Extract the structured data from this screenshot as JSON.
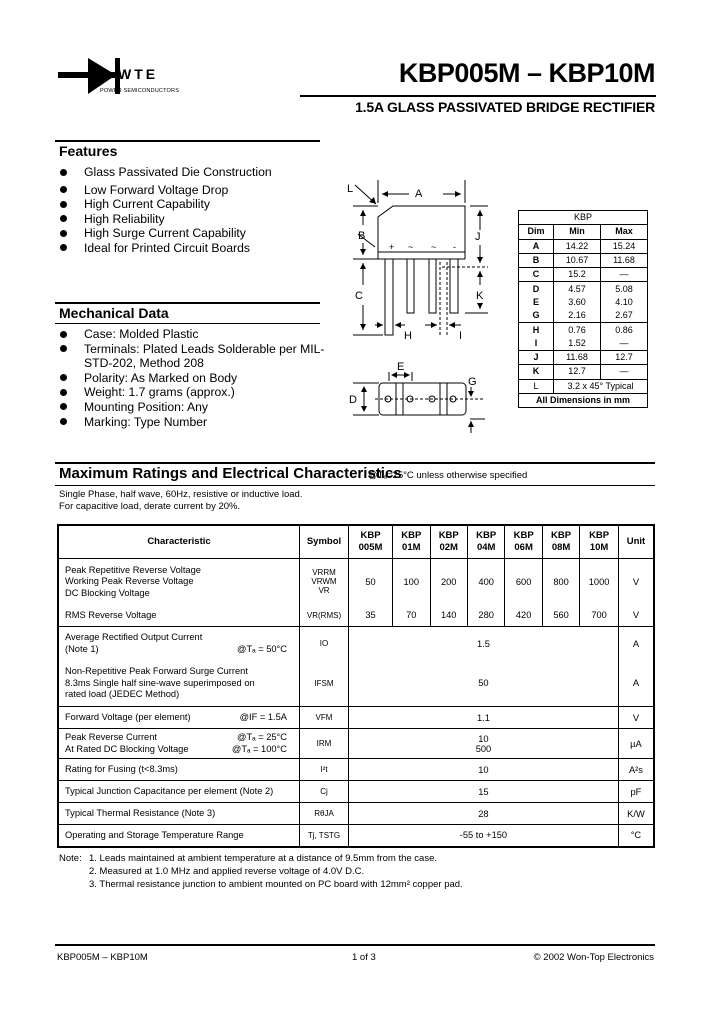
{
  "header": {
    "logo_text": "WTE",
    "logo_subtext": "POWER SEMICONDUCTORS",
    "title": "KBP005M – KBP10M",
    "subtitle": "1.5A GLASS PASSIVATED BRIDGE RECTIFIER"
  },
  "features": {
    "heading": "Features",
    "items": [
      "Glass Passivated Die Construction",
      "Low Forward Voltage Drop",
      "High Current Capability",
      "High Reliability",
      "High Surge Current Capability",
      "Ideal for Printed Circuit Boards"
    ]
  },
  "mechanical": {
    "heading": "Mechanical Data",
    "items": [
      "Case: Molded Plastic",
      "Terminals: Plated Leads Solderable per MIL-STD-202, Method 208",
      "Polarity: As Marked on Body",
      "Weight: 1.7 grams (approx.)",
      "Mounting Position: Any",
      "Marking: Type Number"
    ]
  },
  "diagram": {
    "labels": [
      "L",
      "A",
      "B",
      "J",
      "C",
      "K",
      "H",
      "I",
      "E",
      "D",
      "G"
    ],
    "pin_marks": [
      "+",
      "~",
      "~",
      "-"
    ]
  },
  "dimensions": {
    "package": "KBP",
    "headers": [
      "Dim",
      "Min",
      "Max"
    ],
    "rows": [
      {
        "dim": "A",
        "min": "14.22",
        "max": "15.24"
      },
      {
        "dim": "B",
        "min": "10.67",
        "max": "11.68"
      },
      {
        "dim": "C",
        "min": "15.2",
        "max": "—"
      },
      {
        "dim": "D",
        "min": "4.57",
        "max": "5.08"
      },
      {
        "dim": "E",
        "min": "3.60",
        "max": "4.10"
      },
      {
        "dim": "G",
        "min": "2.16",
        "max": "2.67"
      },
      {
        "dim": "H",
        "min": "0.76",
        "max": "0.86"
      },
      {
        "dim": "I",
        "min": "1.52",
        "max": "—"
      },
      {
        "dim": "J",
        "min": "11.68",
        "max": "12.7"
      },
      {
        "dim": "K",
        "min": "12.7",
        "max": "—"
      },
      {
        "dim": "L",
        "span": "3.2 x 45° Typical"
      }
    ],
    "footer": "All Dimensions in mm"
  },
  "ratings": {
    "heading": "Maximum Ratings and Electrical Characteristics",
    "condition": "@Tₐ=25°C unless otherwise specified",
    "notes": [
      "Single Phase, half wave, 60Hz, resistive or inductive load.",
      "For capacitive load, derate current by 20%."
    ],
    "headers": {
      "characteristic": "Characteristic",
      "symbol": "Symbol",
      "parts": [
        [
          "KBP",
          "005M"
        ],
        [
          "KBP",
          "01M"
        ],
        [
          "KBP",
          "02M"
        ],
        [
          "KBP",
          "04M"
        ],
        [
          "KBP",
          "06M"
        ],
        [
          "KBP",
          "08M"
        ],
        [
          "KBP",
          "10M"
        ]
      ],
      "unit": "Unit"
    },
    "rows": [
      {
        "lines": [
          "Peak Repetitive Reverse Voltage",
          "Working Peak Reverse Voltage",
          "DC Blocking Voltage"
        ],
        "symbols": [
          "VRRM",
          "VRWM",
          "VR"
        ],
        "values": [
          "50",
          "100",
          "200",
          "400",
          "600",
          "800",
          "1000"
        ],
        "unit": "V"
      },
      {
        "lines": [
          "RMS Reverse Voltage"
        ],
        "symbols": [
          "VR(RMS)"
        ],
        "values": [
          "35",
          "70",
          "140",
          "280",
          "420",
          "560",
          "700"
        ],
        "unit": "V"
      },
      {
        "lines": [
          "Average Rectified Output Current",
          "(Note 1)"
        ],
        "condition": "@Tₐ = 50°C",
        "symbols": [
          "IO"
        ],
        "value": "1.5",
        "unit": "A"
      },
      {
        "lines": [
          "Non-Repetitive Peak Forward Surge Current",
          "8.3ms Single half sine-wave superimposed on",
          "rated load (JEDEC Method)"
        ],
        "symbols": [
          "IFSM"
        ],
        "value": "50",
        "unit": "A"
      },
      {
        "lines": [
          "Forward Voltage (per element)"
        ],
        "condition": "@IF = 1.5A",
        "symbols": [
          "VFM"
        ],
        "value": "1.1",
        "unit": "V"
      },
      {
        "lines": [
          "Peak Reverse Current",
          "At Rated DC Blocking Voltage"
        ],
        "conditions": [
          "@Tₐ = 25°C",
          "@Tₐ = 100°C"
        ],
        "symbols": [
          "IRM"
        ],
        "values2": [
          "10",
          "500"
        ],
        "unit": "µA"
      },
      {
        "lines": [
          "Rating for Fusing (t<8.3ms)"
        ],
        "symbols": [
          "I²t"
        ],
        "value": "10",
        "unit": "A²s"
      },
      {
        "lines": [
          "Typical Junction Capacitance per element (Note 2)"
        ],
        "symbols": [
          "Cj"
        ],
        "value": "15",
        "unit": "pF"
      },
      {
        "lines": [
          "Typical Thermal Resistance (Note 3)"
        ],
        "symbols": [
          "RθJA"
        ],
        "value": "28",
        "unit": "K/W"
      },
      {
        "lines": [
          "Operating and Storage Temperature Range"
        ],
        "symbols": [
          "Tj, TSTG"
        ],
        "value": "-55 to +150",
        "unit": "°C"
      }
    ]
  },
  "footnotes": {
    "label": "Note:",
    "items": [
      "1. Leads maintained at ambient temperature at a distance of 9.5mm from the case.",
      "2. Measured at 1.0 MHz and applied reverse voltage of 4.0V D.C.",
      "3. Thermal resistance junction to ambient mounted on PC board with 12mm² copper pad."
    ]
  },
  "footer": {
    "left": "KBP005M – KBP10M",
    "center": "1 of 3",
    "right": "© 2002 Won-Top Electronics"
  }
}
